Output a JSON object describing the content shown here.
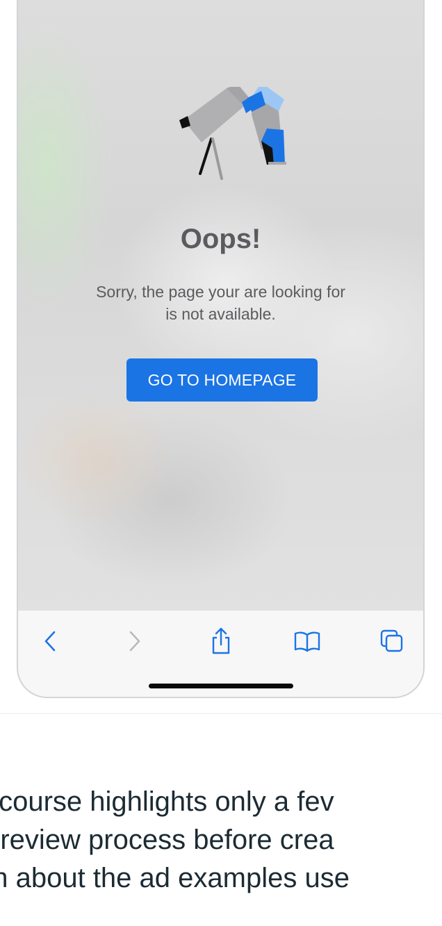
{
  "error_page": {
    "title": "Oops!",
    "message_line1": "Sorry, the page your are looking for",
    "message_line2": "is not available.",
    "button_label": "GO TO HOMEPAGE"
  },
  "browser_toolbar": {
    "items": [
      {
        "name": "back",
        "icon": "chevron-left-icon",
        "enabled": true
      },
      {
        "name": "forward",
        "icon": "chevron-right-icon",
        "enabled": false
      },
      {
        "name": "share",
        "icon": "share-icon",
        "enabled": true
      },
      {
        "name": "bookmarks",
        "icon": "book-icon",
        "enabled": true
      },
      {
        "name": "tabs",
        "icon": "tabs-icon",
        "enabled": true
      }
    ]
  },
  "article": {
    "lines": [
      "s course highlights only a fev",
      "g review process before crea",
      "on about the ad examples use"
    ]
  },
  "colors": {
    "accent": "#1b74e4",
    "toolbar_icon": "#1b74e4",
    "disabled_icon": "#b9b9bd",
    "heading_text": "#5b5b5f",
    "body_text": "#1c2b33"
  }
}
